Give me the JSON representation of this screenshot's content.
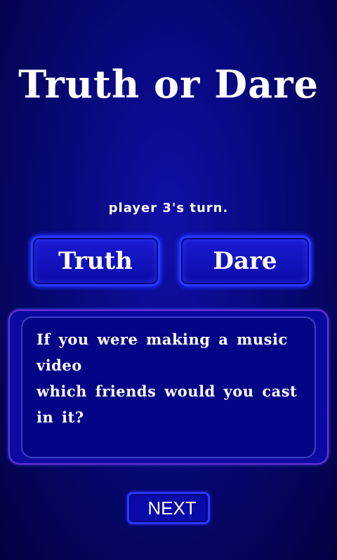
{
  "app": {
    "title": "Truth or Dare"
  },
  "status": {
    "turn_text": "player 3's turn."
  },
  "choices": {
    "truth_label": "Truth",
    "dare_label": "Dare"
  },
  "question": {
    "line1": "If you were making a music video",
    "line2": "which friends would you cast",
    "line3": "in it?"
  },
  "controls": {
    "next_label": "NEXT"
  },
  "colors": {
    "background": "#08087a",
    "button_fill": "#1010c0",
    "button_border": "#2a38ff",
    "text": "#ffffff"
  }
}
